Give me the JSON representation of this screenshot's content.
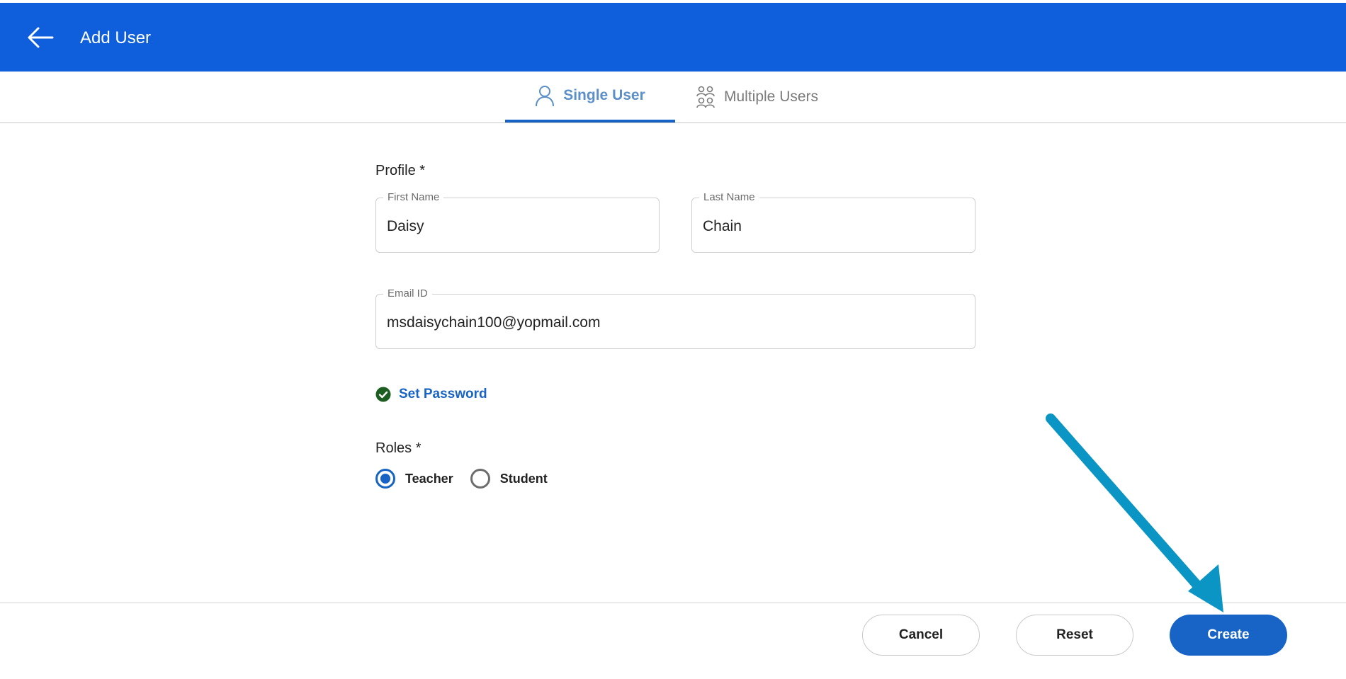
{
  "header": {
    "title": "Add User",
    "back_icon": "arrow-left-icon",
    "background": "#0f5fdc"
  },
  "tabs": [
    {
      "label": "Single User",
      "icon": "user-icon",
      "active": true
    },
    {
      "label": "Multiple Users",
      "icon": "users-group-icon",
      "active": false
    }
  ],
  "profile": {
    "label": "Profile *",
    "first_name": {
      "legend": "First Name",
      "value": "Daisy"
    },
    "last_name": {
      "legend": "Last Name",
      "value": "Chain"
    },
    "email": {
      "legend": "Email ID",
      "value": "msdaisychain100@yopmail.com"
    }
  },
  "password": {
    "label": "Set Password",
    "icon": "check-circle-icon",
    "status_color": "#1b5e20"
  },
  "roles": {
    "label": "Roles *",
    "options": [
      {
        "label": "Teacher",
        "selected": true
      },
      {
        "label": "Student",
        "selected": false
      }
    ]
  },
  "footer": {
    "cancel_label": "Cancel",
    "reset_label": "Reset",
    "create_label": "Create"
  },
  "colors": {
    "accent": "#1763c6",
    "annotation_arrow": "#0a95c4"
  }
}
